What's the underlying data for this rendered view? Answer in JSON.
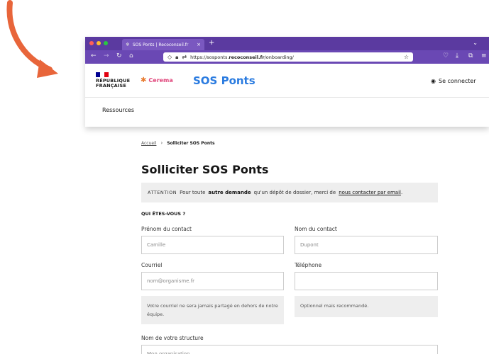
{
  "browser": {
    "tab_title": "SOS Ponts | Recoconseil.fr",
    "url_prefix": "https://sosponts.",
    "url_domain": "recoconseil.fr",
    "url_path": "/onboarding/"
  },
  "header": {
    "rf_line1": "RÉPUBLIQUE",
    "rf_line2": "FRANÇAISE",
    "partner": "Cerema",
    "title": "SOS Ponts",
    "login": "Se connecter",
    "menu_item": "Ressources"
  },
  "breadcrumb": {
    "home": "Accueil",
    "current": "Solliciter SOS Ponts"
  },
  "page": {
    "title": "Solliciter SOS Ponts",
    "notice_tag": "ATTENTION",
    "notice_before": "Pour toute",
    "notice_bold": "autre demande",
    "notice_middle": "qu'un dépôt de dossier, merci de",
    "notice_link": "nous contacter par email",
    "notice_end": ".",
    "section": "QUI ÊTES-VOUS ?"
  },
  "form": {
    "firstname_label": "Prénom du contact",
    "firstname_placeholder": "Camille",
    "lastname_label": "Nom du contact",
    "lastname_placeholder": "Dupont",
    "email_label": "Courriel",
    "email_placeholder": "nom@organisme.fr",
    "phone_label": "Téléphone",
    "phone_placeholder": "",
    "email_hint": "Votre courriel ne sera jamais partagé en dehors de notre équipe.",
    "phone_hint": "Optionnel mais recommandé.",
    "structure_label": "Nom de votre structure",
    "structure_placeholder": "Mon organisation"
  },
  "colors": {
    "arrow": "#e8653a",
    "browser_chrome": "#5b3aa0",
    "brand_blue": "#2a7be0",
    "flag_blue": "#000091",
    "flag_red": "#e1000f"
  }
}
